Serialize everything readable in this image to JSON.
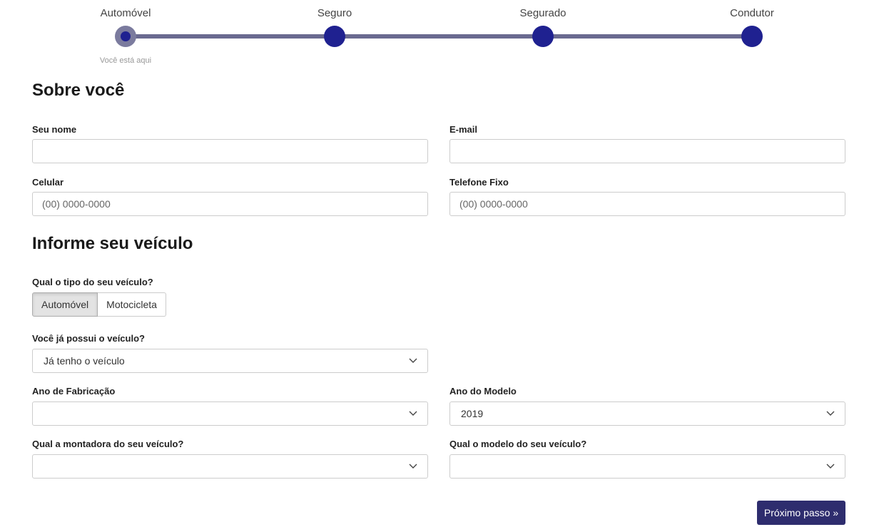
{
  "stepper": {
    "steps": [
      {
        "label": "Automóvel"
      },
      {
        "label": "Seguro"
      },
      {
        "label": "Segurado"
      },
      {
        "label": "Condutor"
      }
    ],
    "current_note": "Você está aqui",
    "colors": {
      "active": "#1f2190",
      "track": "#6a6a90"
    }
  },
  "about": {
    "title": "Sobre você",
    "name_label": "Seu nome",
    "name_value": "",
    "email_label": "E-mail",
    "email_value": "",
    "cell_label": "Celular",
    "cell_placeholder": "(00) 0000-0000",
    "phone_label": "Telefone Fixo",
    "phone_placeholder": "(00) 0000-0000"
  },
  "vehicle": {
    "title": "Informe seu veículo",
    "type_label": "Qual o tipo do seu veículo?",
    "type_options": [
      "Automóvel",
      "Motocicleta"
    ],
    "type_selected": "Automóvel",
    "owns_label": "Você já possui o veículo?",
    "owns_value": "Já tenho o veículo",
    "year_made_label": "Ano de Fabricação",
    "year_made_value": "",
    "year_model_label": "Ano do Modelo",
    "year_model_value": "2019",
    "brand_label": "Qual a montadora do seu veículo?",
    "brand_value": "",
    "model_label": "Qual o modelo do seu veículo?",
    "model_value": ""
  },
  "actions": {
    "next_label": "Próximo passo »",
    "next_color": "#2e2d6e"
  }
}
